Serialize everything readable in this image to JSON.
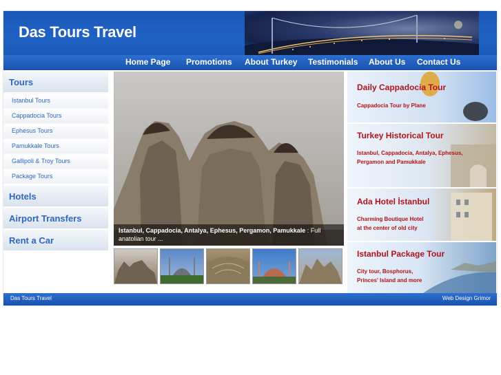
{
  "header": {
    "site_title": "Das Tours Travel"
  },
  "nav": {
    "items": [
      "Home Page",
      "Promotions",
      "About Turkey",
      "Testimonials",
      "About Us",
      "Contact Us"
    ]
  },
  "sidebar": {
    "tours_label": "Tours",
    "tour_items": [
      "Istanbul Tours",
      "Cappadocia Tours",
      "Ephesus Tours",
      "Pamukkale Tours",
      "Gallipoli & Troy Tours",
      "Package Tours"
    ],
    "hotels_label": "Hotels",
    "airport_label": "Airport Transfers",
    "rentacar_label": "Rent a Car"
  },
  "slideshow": {
    "caption_bold": "Istanbul, Cappadocia, Antalya, Ephesus, Pergamon, Pamukkale",
    "caption_rest": " : Full anatolian tour ..."
  },
  "promos": [
    {
      "title": "Daily Cappadocia Tour",
      "lines": [
        "Cappadocia Tour by Plane"
      ]
    },
    {
      "title": "Turkey Historical Tour",
      "lines": [
        "Istanbul, Cappadocia, Antalya, Ephesus,",
        "Pergamon and Pamukkale"
      ]
    },
    {
      "title": "Ada Hotel İstanbul",
      "lines": [
        "Charming Boutique Hotel",
        "at the center of old city"
      ]
    },
    {
      "title": "Istanbul Package Tour",
      "lines": [
        "City tour, Bosphorus,",
        "Princes' Island and more"
      ]
    }
  ],
  "footer": {
    "left": "Das Tours Travel",
    "right": "Web Design Grimor"
  }
}
